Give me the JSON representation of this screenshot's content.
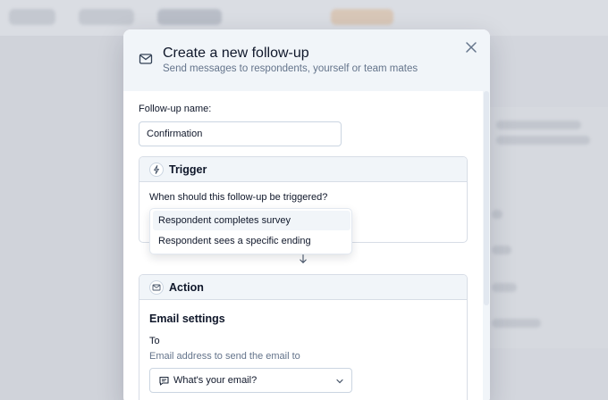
{
  "modal": {
    "title": "Create a new follow-up",
    "subtitle": "Send messages to respondents, yourself or team mates",
    "close_icon": "close-icon",
    "header_icon": "mail-icon"
  },
  "name_field": {
    "label": "Follow-up name:",
    "value": "Confirmation"
  },
  "trigger": {
    "title": "Trigger",
    "icon": "bolt-icon",
    "question": "When should this follow-up be triggered?",
    "options": [
      {
        "label": "Respondent completes survey",
        "highlighted": true
      },
      {
        "label": "Respondent sees a specific ending",
        "highlighted": false
      }
    ]
  },
  "action": {
    "title": "Action",
    "icon": "mail-icon",
    "email_settings_title": "Email settings",
    "to_label": "To",
    "to_help": "Email address to send the email to",
    "to_value": "What's your email?",
    "to_value_icon": "message-icon"
  },
  "colors": {
    "header_bg": "#f1f5f9",
    "border": "#d7dde6",
    "muted_text": "#64748b",
    "text": "#0f172a"
  }
}
